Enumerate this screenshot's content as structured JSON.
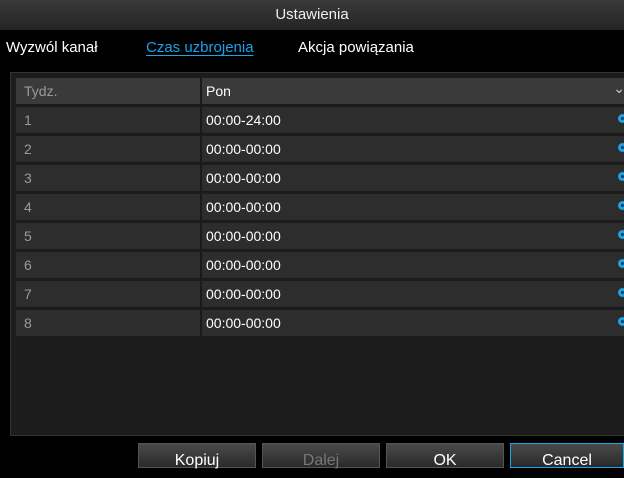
{
  "window": {
    "title": "Ustawienia"
  },
  "tabs": [
    {
      "label": "Wyzwól kanał",
      "active": false
    },
    {
      "label": "Czas uzbrojenia",
      "active": true
    },
    {
      "label": "Akcja powiązania",
      "active": false
    }
  ],
  "schedule": {
    "day_label": "Tydz.",
    "day_value": "Pon",
    "rows": [
      {
        "index": "1",
        "time": "00:00-24:00"
      },
      {
        "index": "2",
        "time": "00:00-00:00"
      },
      {
        "index": "3",
        "time": "00:00-00:00"
      },
      {
        "index": "4",
        "time": "00:00-00:00"
      },
      {
        "index": "5",
        "time": "00:00-00:00"
      },
      {
        "index": "6",
        "time": "00:00-00:00"
      },
      {
        "index": "7",
        "time": "00:00-00:00"
      },
      {
        "index": "8",
        "time": "00:00-00:00"
      }
    ]
  },
  "buttons": {
    "copy": "Kopiuj",
    "next": "Dalej",
    "ok": "OK",
    "cancel": "Cancel"
  },
  "colors": {
    "accent": "#1aa3e8",
    "panel": "#1c1c1c",
    "row": "#2d2d2d"
  },
  "icons": {
    "row_icon": "clock-icon",
    "dropdown": "chevron-down-icon"
  }
}
